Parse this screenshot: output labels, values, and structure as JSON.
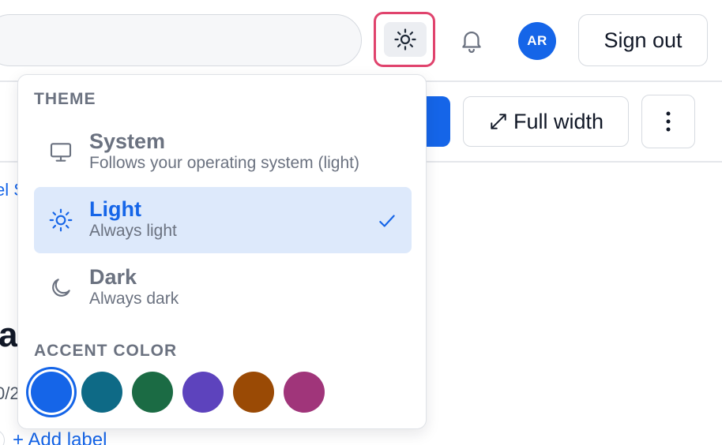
{
  "header": {
    "sign_out_label": "Sign out",
    "avatar_initials": "AR",
    "theme_icon": "sun-icon",
    "notifications_icon": "bell-icon"
  },
  "toolbar": {
    "full_width_label": "Full width",
    "full_width_icon": "expand-diagonal-icon",
    "more_icon": "vertical-ellipsis-icon"
  },
  "background_page": {
    "link_fragment": "el S",
    "title_fragment": "a",
    "date_fragment": "0/2",
    "add_label": "+ Add label"
  },
  "theme_menu": {
    "theme_heading": "THEME",
    "options": [
      {
        "title": "System",
        "subtitle": "Follows your operating system (light)",
        "icon": "monitor-icon",
        "selected": false
      },
      {
        "title": "Light",
        "subtitle": "Always light",
        "icon": "sun-icon",
        "selected": true
      },
      {
        "title": "Dark",
        "subtitle": "Always dark",
        "icon": "moon-icon",
        "selected": false
      }
    ],
    "accent_heading": "ACCENT COLOR",
    "accent_colors": [
      "#1565e8",
      "#0e6a86",
      "#1b6b44",
      "#5d43bd",
      "#9a4a05",
      "#a0357a"
    ],
    "selected_accent_index": 0
  },
  "colors": {
    "accent": "#1565e8",
    "focus_ring": "#e0436d",
    "selected_row_bg": "#dde9fb"
  }
}
